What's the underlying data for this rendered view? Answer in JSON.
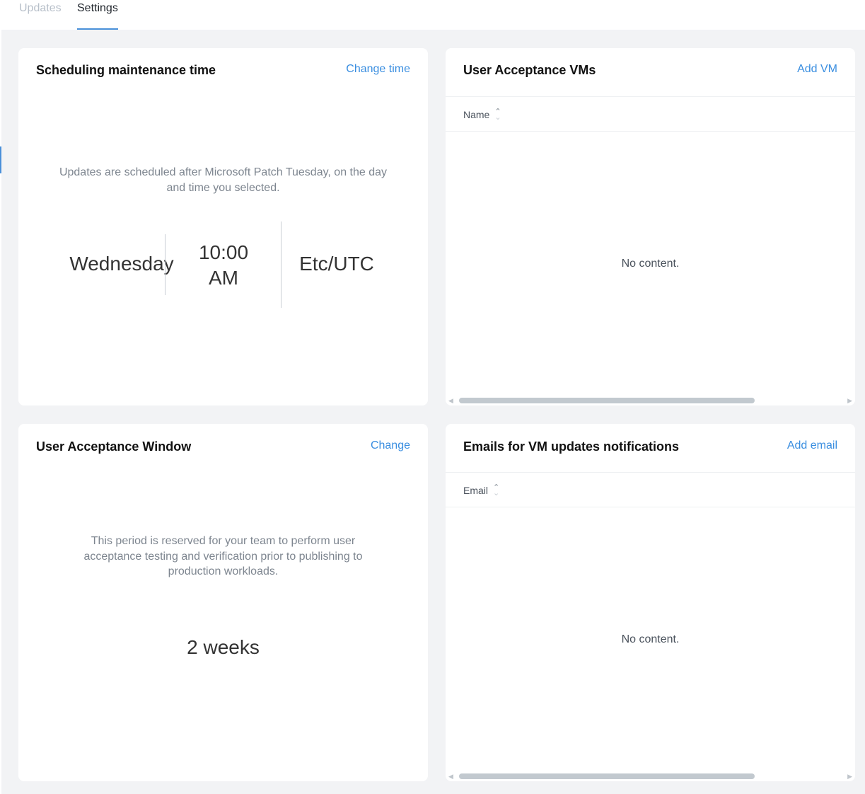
{
  "tabs": [
    {
      "label": "Updates",
      "active": false
    },
    {
      "label": "Settings",
      "active": true
    }
  ],
  "schedule_card": {
    "title": "Scheduling maintenance time",
    "action": "Change time",
    "description": "Updates are scheduled after Microsoft Patch Tuesday, on the day and time you selected.",
    "day": "Wednesday",
    "time_line1": "10:00",
    "time_line2": "AM",
    "timezone": "Etc/UTC"
  },
  "vms_card": {
    "title": "User Acceptance VMs",
    "action": "Add VM",
    "column": "Name",
    "empty_text": "No content."
  },
  "window_card": {
    "title": "User Acceptance Window",
    "action": "Change",
    "description": "This period is reserved for your team to perform user acceptance testing and verification prior to publishing to production workloads.",
    "value": "2 weeks"
  },
  "emails_card": {
    "title": "Emails for VM updates notifications",
    "action": "Add email",
    "column": "Email",
    "empty_text": "No content."
  },
  "icons": {
    "sort": "sort-icon",
    "scroll_left": "scroll-left-arrow-icon",
    "scroll_right": "scroll-right-arrow-icon"
  },
  "colors": {
    "accent": "#3a8ee0",
    "background": "#f2f3f5",
    "card": "#ffffff"
  }
}
